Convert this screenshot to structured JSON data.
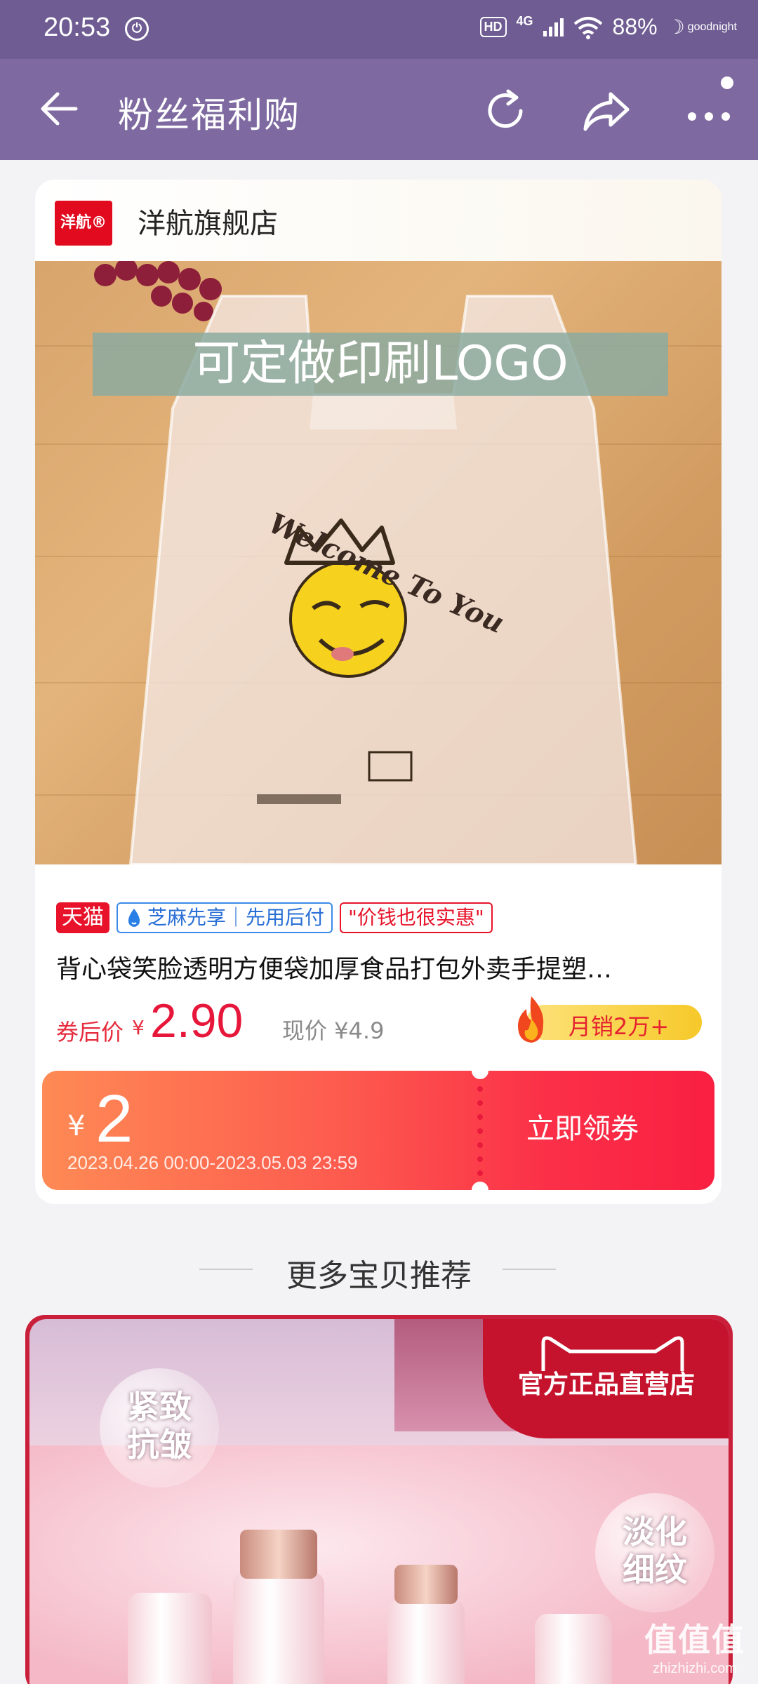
{
  "status_bar": {
    "time": "20:53",
    "hd": "HD",
    "network": "4G",
    "battery": "88%",
    "mode": "goodnight"
  },
  "header": {
    "title": "粉丝福利购"
  },
  "product_card": {
    "store_logo": "洋航®",
    "store_name": "洋航旗舰店",
    "banner_text": "可定做印刷LOGO",
    "bag_print": "Welcome To You",
    "tags": {
      "tmall": "天猫",
      "zhima": "芝麻先享｜先用后付",
      "cheap": "\"价钱也很实惠\""
    },
    "title": "背心袋笑脸透明方便袋加厚食品打包外卖手提塑…",
    "price": {
      "after_label": "券后价",
      "currency": "¥",
      "value": "2.90",
      "now": "现价 ¥4.9",
      "monthly_sales": "月销2万+"
    },
    "coupon": {
      "currency": "¥",
      "amount": "2",
      "period": "2023.04.26 00:00-2023.05.03 23:59",
      "button": "立即领券"
    }
  },
  "recommend": {
    "title": "更多宝贝推荐",
    "card": {
      "badge": "官方正品直营店",
      "bubble_1": "紧致\n抗皱",
      "bubble_2": "淡化\n细纹"
    }
  },
  "watermark": {
    "big": "值值值",
    "small": "zhizhizhi.com"
  },
  "colors": {
    "header_bg": "#7e6aa1",
    "status_bg": "#6e5c93",
    "price_red": "#e6173a",
    "tmall_red": "#e8132a",
    "zhima_blue": "#3a8be8"
  }
}
